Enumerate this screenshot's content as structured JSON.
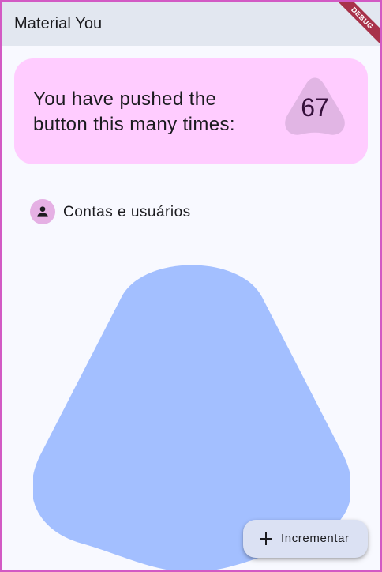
{
  "app": {
    "title": "Material You"
  },
  "debug_banner": {
    "label": "DEBUG"
  },
  "counter": {
    "message": "You have pushed the button this many times:",
    "value": "67"
  },
  "account": {
    "icon": "person-icon",
    "label": "Contas e usuários"
  },
  "fab": {
    "icon": "plus-icon",
    "label": "Incrementar"
  },
  "colors": {
    "appbar": "#e2e7f0",
    "background": "#f8f9ff",
    "counter_card": "#ffccff",
    "counter_shape": "#e1b5e4",
    "avatar": "#e5b0e4",
    "big_shape": "#a3bfff",
    "fab": "#dbe1f3",
    "frame_border": "#d25ac4"
  }
}
